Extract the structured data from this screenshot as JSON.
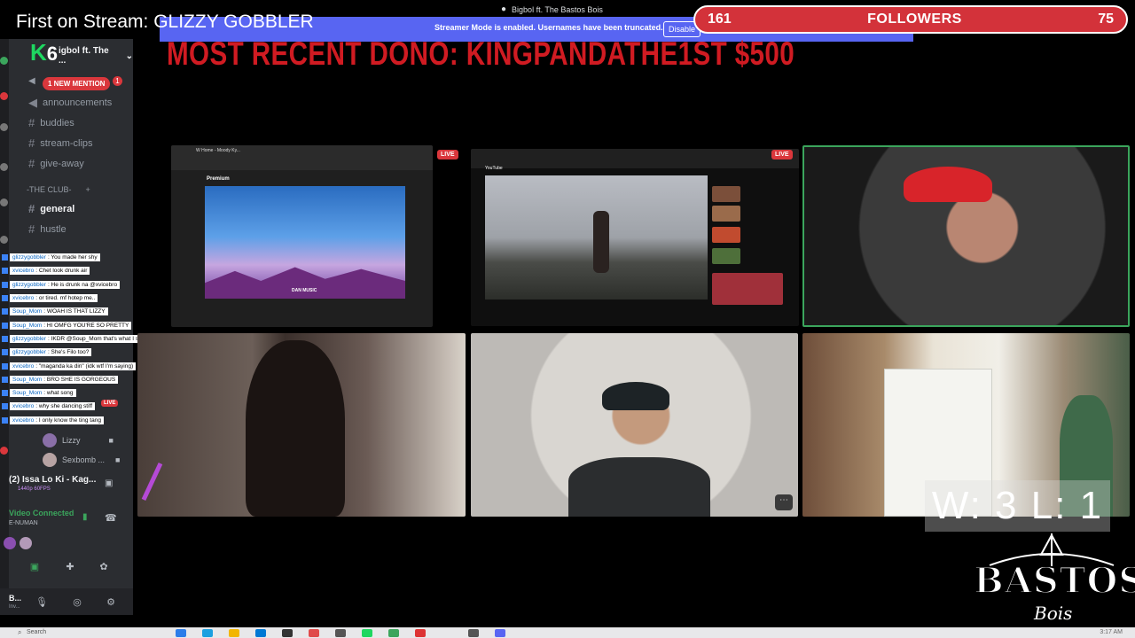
{
  "window": {
    "title": "Bigbol ft. The Bastos Bois"
  },
  "overlay": {
    "first_on_stream": "First on Stream: GLIZZY GOBBLER",
    "followers_left": "161",
    "followers_label": "FOLLOWERS",
    "followers_right": "75",
    "recent_dono": "MOST RECENT DONO: KINGPANDATHE1ST $500",
    "score": "W: 3 L: 1",
    "logo_word": "BASTOS",
    "logo_sub": "Bois"
  },
  "discord_notice": {
    "text": "Streamer Mode is enabled. Usernames have been truncated.",
    "button": "Disable"
  },
  "server": {
    "name": "igbol ft. The ...",
    "badge_letter": "K",
    "badge_num": "6",
    "mention_pill": "1 NEW MENTION",
    "mention_count": "1"
  },
  "channels": [
    {
      "name": "announcements"
    },
    {
      "name": "buddies"
    },
    {
      "name": "stream-clips"
    },
    {
      "name": "give-away"
    }
  ],
  "category": "-THE CLUB-",
  "channels2": [
    {
      "name": "general"
    },
    {
      "name": "hustle"
    }
  ],
  "chat": [
    {
      "user": "glizzygobbler",
      "text": ": You made her shy"
    },
    {
      "user": "xvicebro",
      "text": ": Chet look drunk air"
    },
    {
      "user": "glizzygobbler",
      "text": ": He is drunk na @xvicebro"
    },
    {
      "user": "xvicebro",
      "text": ": or tired. mf hotep me.."
    },
    {
      "user": "Soup_Mom",
      "text": ": WOAH IS THAT LIZZY"
    },
    {
      "user": "Soup_Mom",
      "text": ": HI OMFG YOU'RE SO PRETTY"
    },
    {
      "user": "glizzygobbler",
      "text": ": IKDR @Soup_Mom that's what I said"
    },
    {
      "user": "glizzygobbler",
      "text": ": She's Filo too?"
    },
    {
      "user": "xvicebro",
      "text": ": \"maganda ka din\" (idk wtf I'm saying)"
    },
    {
      "user": "Soup_Mom",
      "text": ": BRO SHE IS GORGEOUS"
    },
    {
      "user": "Soup_Mom",
      "text": ": what song"
    },
    {
      "user": "xvicebro",
      "text": ": why she dancing stiff"
    },
    {
      "user": "xvicebro",
      "text": ": I only know the ting tang"
    }
  ],
  "voice_users": [
    {
      "name": "Lizzy"
    },
    {
      "name": "Sexbomb ..."
    }
  ],
  "live_tag": "LIVE",
  "stream_status": {
    "title": "(2) Issa Lo Ki - Kag...",
    "quality": "1440p 60FPS"
  },
  "voice": {
    "status": "Video Connected",
    "channel": "E-NUMAN"
  },
  "user_panel": {
    "name": "B...",
    "sub": "Inv..."
  },
  "tiles": {
    "live_badge": "LIVE",
    "screen1_tab": "W Home - Moody Ky...",
    "screen1_brand": "Premium",
    "screen1_caption": "DAN MUSIC",
    "screen2_brand": "YouTube"
  },
  "taskbar": {
    "search": "Search",
    "clock": "3:17 AM"
  },
  "colors": {
    "discord_blurple": "#5865f2",
    "alert_red": "#d3323a",
    "online_green": "#3ba55c"
  }
}
